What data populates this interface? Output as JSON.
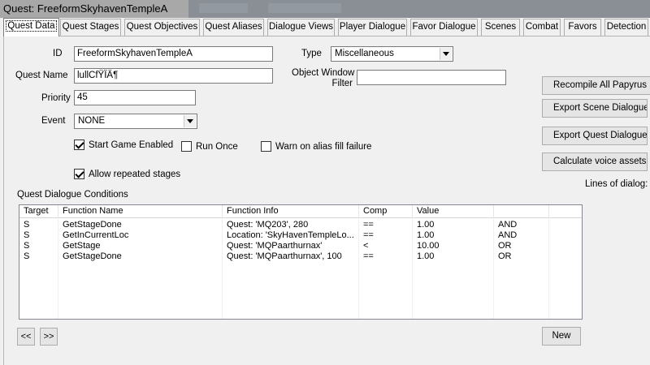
{
  "window": {
    "title": "Quest: FreeformSkyhavenTempleA"
  },
  "tabs": [
    {
      "label": "Quest Data"
    },
    {
      "label": "Quest Stages"
    },
    {
      "label": "Quest Objectives"
    },
    {
      "label": "Quest Aliases"
    },
    {
      "label": "Dialogue Views"
    },
    {
      "label": "Player Dialogue"
    },
    {
      "label": "Favor Dialogue"
    },
    {
      "label": "Scenes"
    },
    {
      "label": "Combat"
    },
    {
      "label": "Favors"
    },
    {
      "label": "Detection"
    }
  ],
  "form": {
    "id_label": "ID",
    "id_value": "FreeformSkyhavenTempleA",
    "type_label": "Type",
    "type_value": "Miscellaneous",
    "quest_name_label": "Quest Name",
    "quest_name_value": "lullCfŸÏÄ¶",
    "owf_label_1": "Object Window",
    "owf_label_2": "Filter",
    "owf_value": "",
    "priority_label": "Priority",
    "priority_value": "45",
    "event_label": "Event",
    "event_value": "NONE",
    "start_game_enabled": "Start Game Enabled",
    "run_once": "Run Once",
    "warn_alias": "Warn on alias fill failure",
    "allow_repeated": "Allow repeated stages"
  },
  "side_buttons": {
    "recompile": "Recompile All Papyrus Scripts",
    "export_scene": "Export Scene Dialogue",
    "export_quest": "Export Quest Dialogue",
    "calc_voice": "Calculate voice assets",
    "lines_of_dialog": "Lines of dialog:"
  },
  "conditions": {
    "label": "Quest Dialogue Conditions",
    "columns": [
      "Target",
      "Function Name",
      "Function Info",
      "Comp",
      "Value",
      ""
    ],
    "rows": [
      [
        "S",
        "GetStageDone",
        "Quest: 'MQ203', 280",
        "==",
        "1.00",
        "AND"
      ],
      [
        "S",
        "GetInCurrentLoc",
        "Location: 'SkyHavenTempleLo...",
        "==",
        "1.00",
        "AND"
      ],
      [
        "S",
        "GetStage",
        "Quest: 'MQPaarthurnax'",
        "<",
        "10.00",
        "OR"
      ],
      [
        "S",
        "GetStageDone",
        "Quest: 'MQPaarthurnax', 100",
        "==",
        "1.00",
        "OR"
      ]
    ],
    "prev_label": "<<",
    "next_label": ">>",
    "new_label": "New"
  }
}
